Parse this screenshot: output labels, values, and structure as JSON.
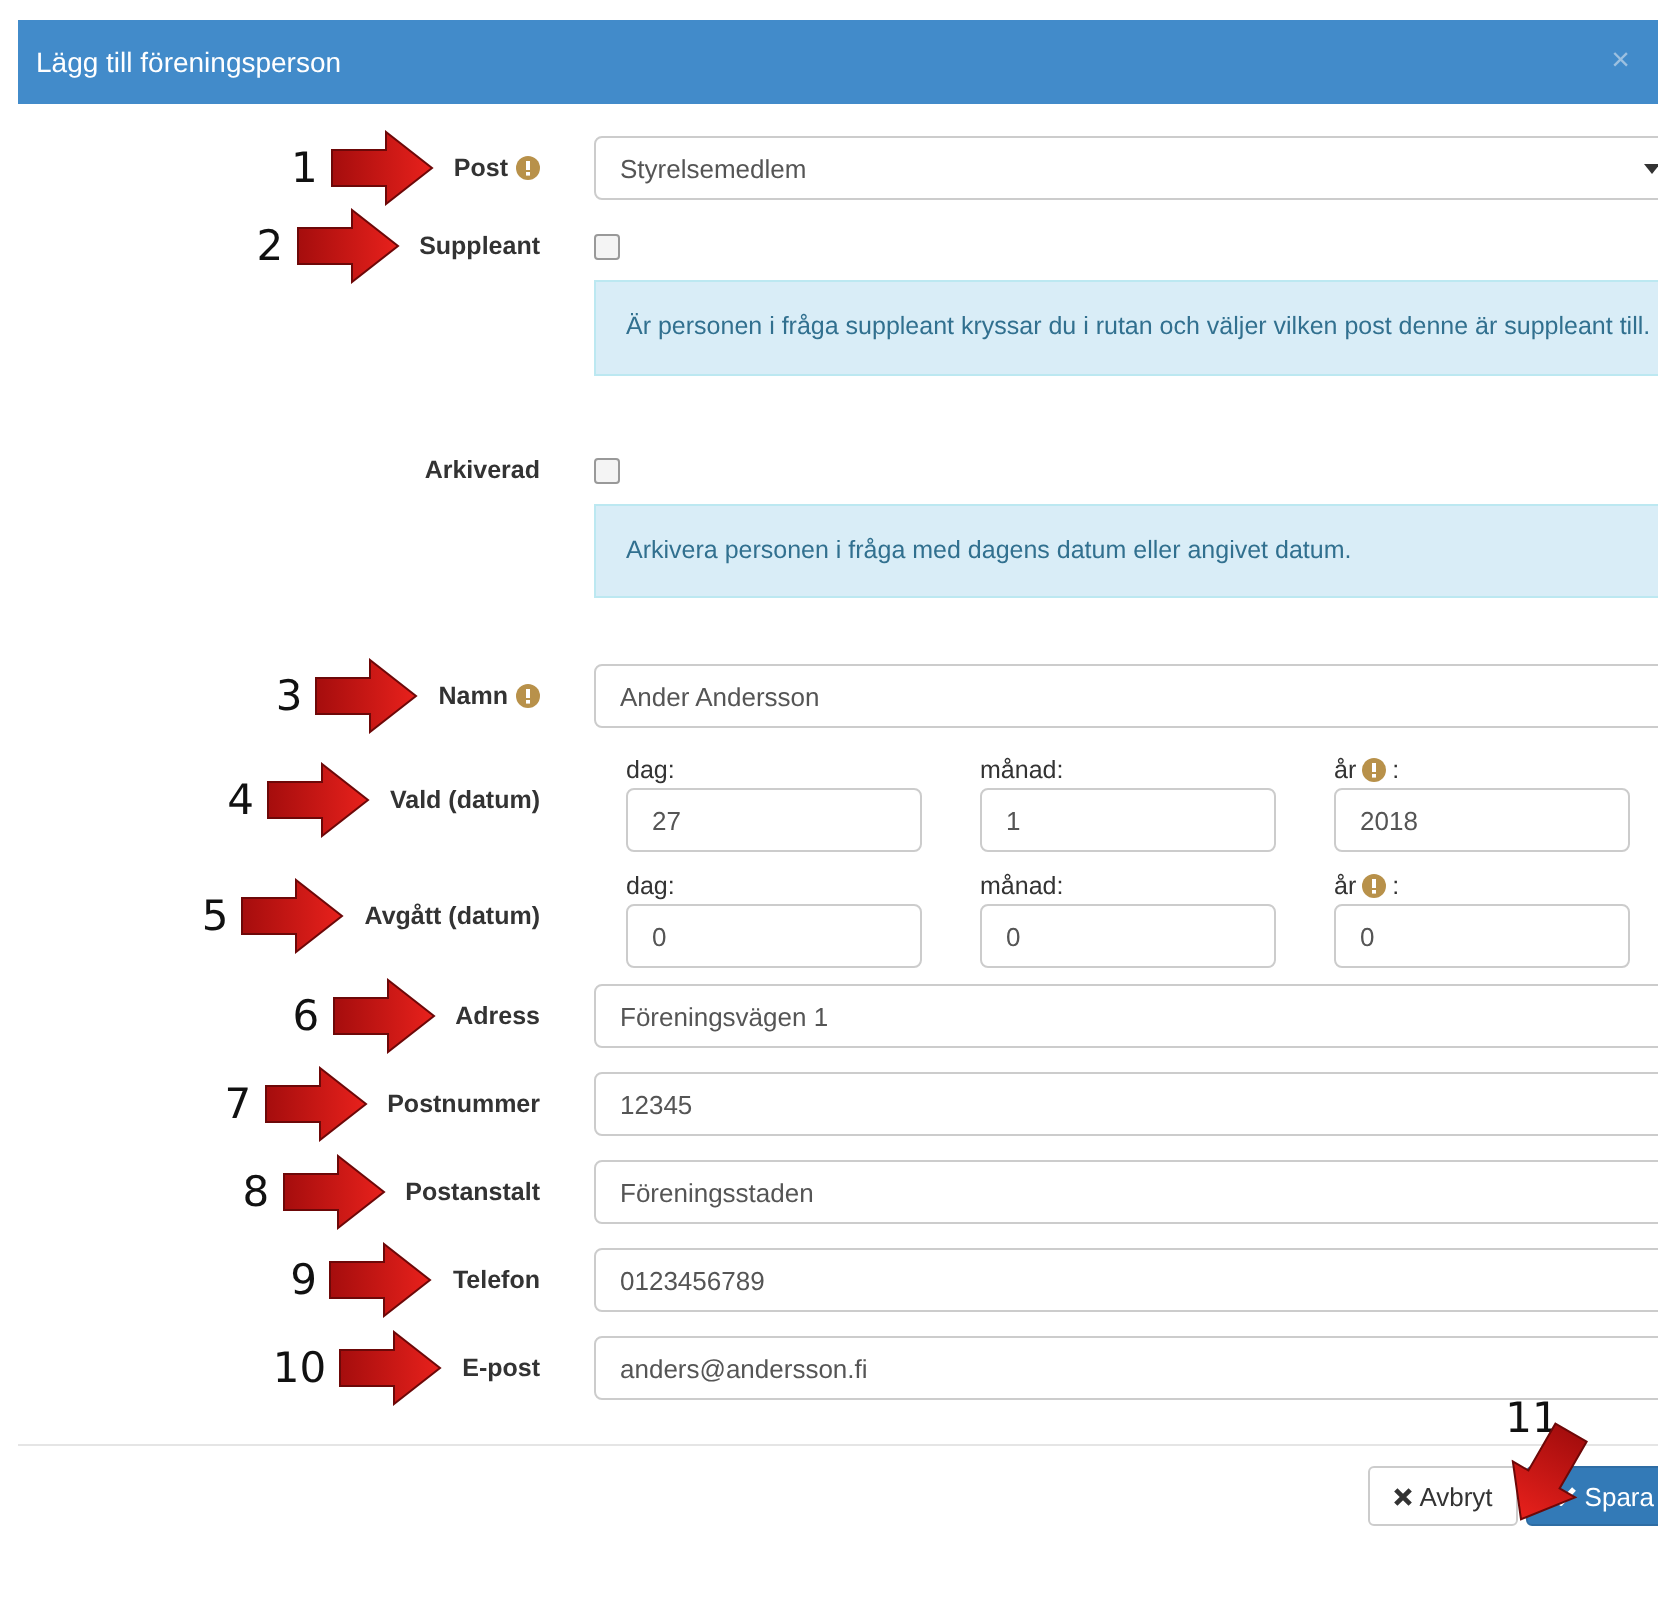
{
  "dialog": {
    "title": "Lägg till föreningsperson",
    "close": "×"
  },
  "fields": [
    {
      "kind": "select",
      "label": "Post",
      "marker": "1",
      "info": true,
      "value": "Styrelsemedlem"
    },
    {
      "kind": "checkbox",
      "label": "Suppleant",
      "marker": "2",
      "checked": false,
      "help": "Är personen i fråga suppleant kryssar du i rutan och väljer vilken post denne är suppleant till."
    },
    {
      "kind": "checkbox",
      "label": "Arkiverad",
      "checked": false,
      "help": "Arkivera personen i fråga med dagens datum eller angivet datum."
    },
    {
      "kind": "text",
      "label": "Namn",
      "marker": "3",
      "info": true,
      "value": "Ander Andersson"
    },
    {
      "kind": "date",
      "label": "Vald (datum)",
      "marker": "4",
      "parts": [
        {
          "label": "dag:",
          "value": "27"
        },
        {
          "label": "månad:",
          "value": "1"
        },
        {
          "label": "år",
          "info": true,
          "after": ":",
          "value": "2018"
        }
      ]
    },
    {
      "kind": "date",
      "label": "Avgått (datum)",
      "marker": "5",
      "parts": [
        {
          "label": "dag:",
          "value": "0"
        },
        {
          "label": "månad:",
          "value": "0"
        },
        {
          "label": "år",
          "info": true,
          "after": ":",
          "value": "0"
        }
      ]
    },
    {
      "kind": "text",
      "label": "Adress",
      "marker": "6",
      "value": "Föreningsvägen 1"
    },
    {
      "kind": "text",
      "label": "Postnummer",
      "marker": "7",
      "value": "12345"
    },
    {
      "kind": "text",
      "label": "Postanstalt",
      "marker": "8",
      "value": "Föreningsstaden"
    },
    {
      "kind": "text",
      "label": "Telefon",
      "marker": "9",
      "value": "0123456789"
    },
    {
      "kind": "text",
      "label": "E-post",
      "marker": "10",
      "value": "anders@andersson.fi"
    }
  ],
  "footer": {
    "marker": "11",
    "buttons": [
      {
        "kind": "cancel",
        "label": "Avbryt"
      },
      {
        "kind": "save",
        "label": "Spara"
      }
    ]
  }
}
